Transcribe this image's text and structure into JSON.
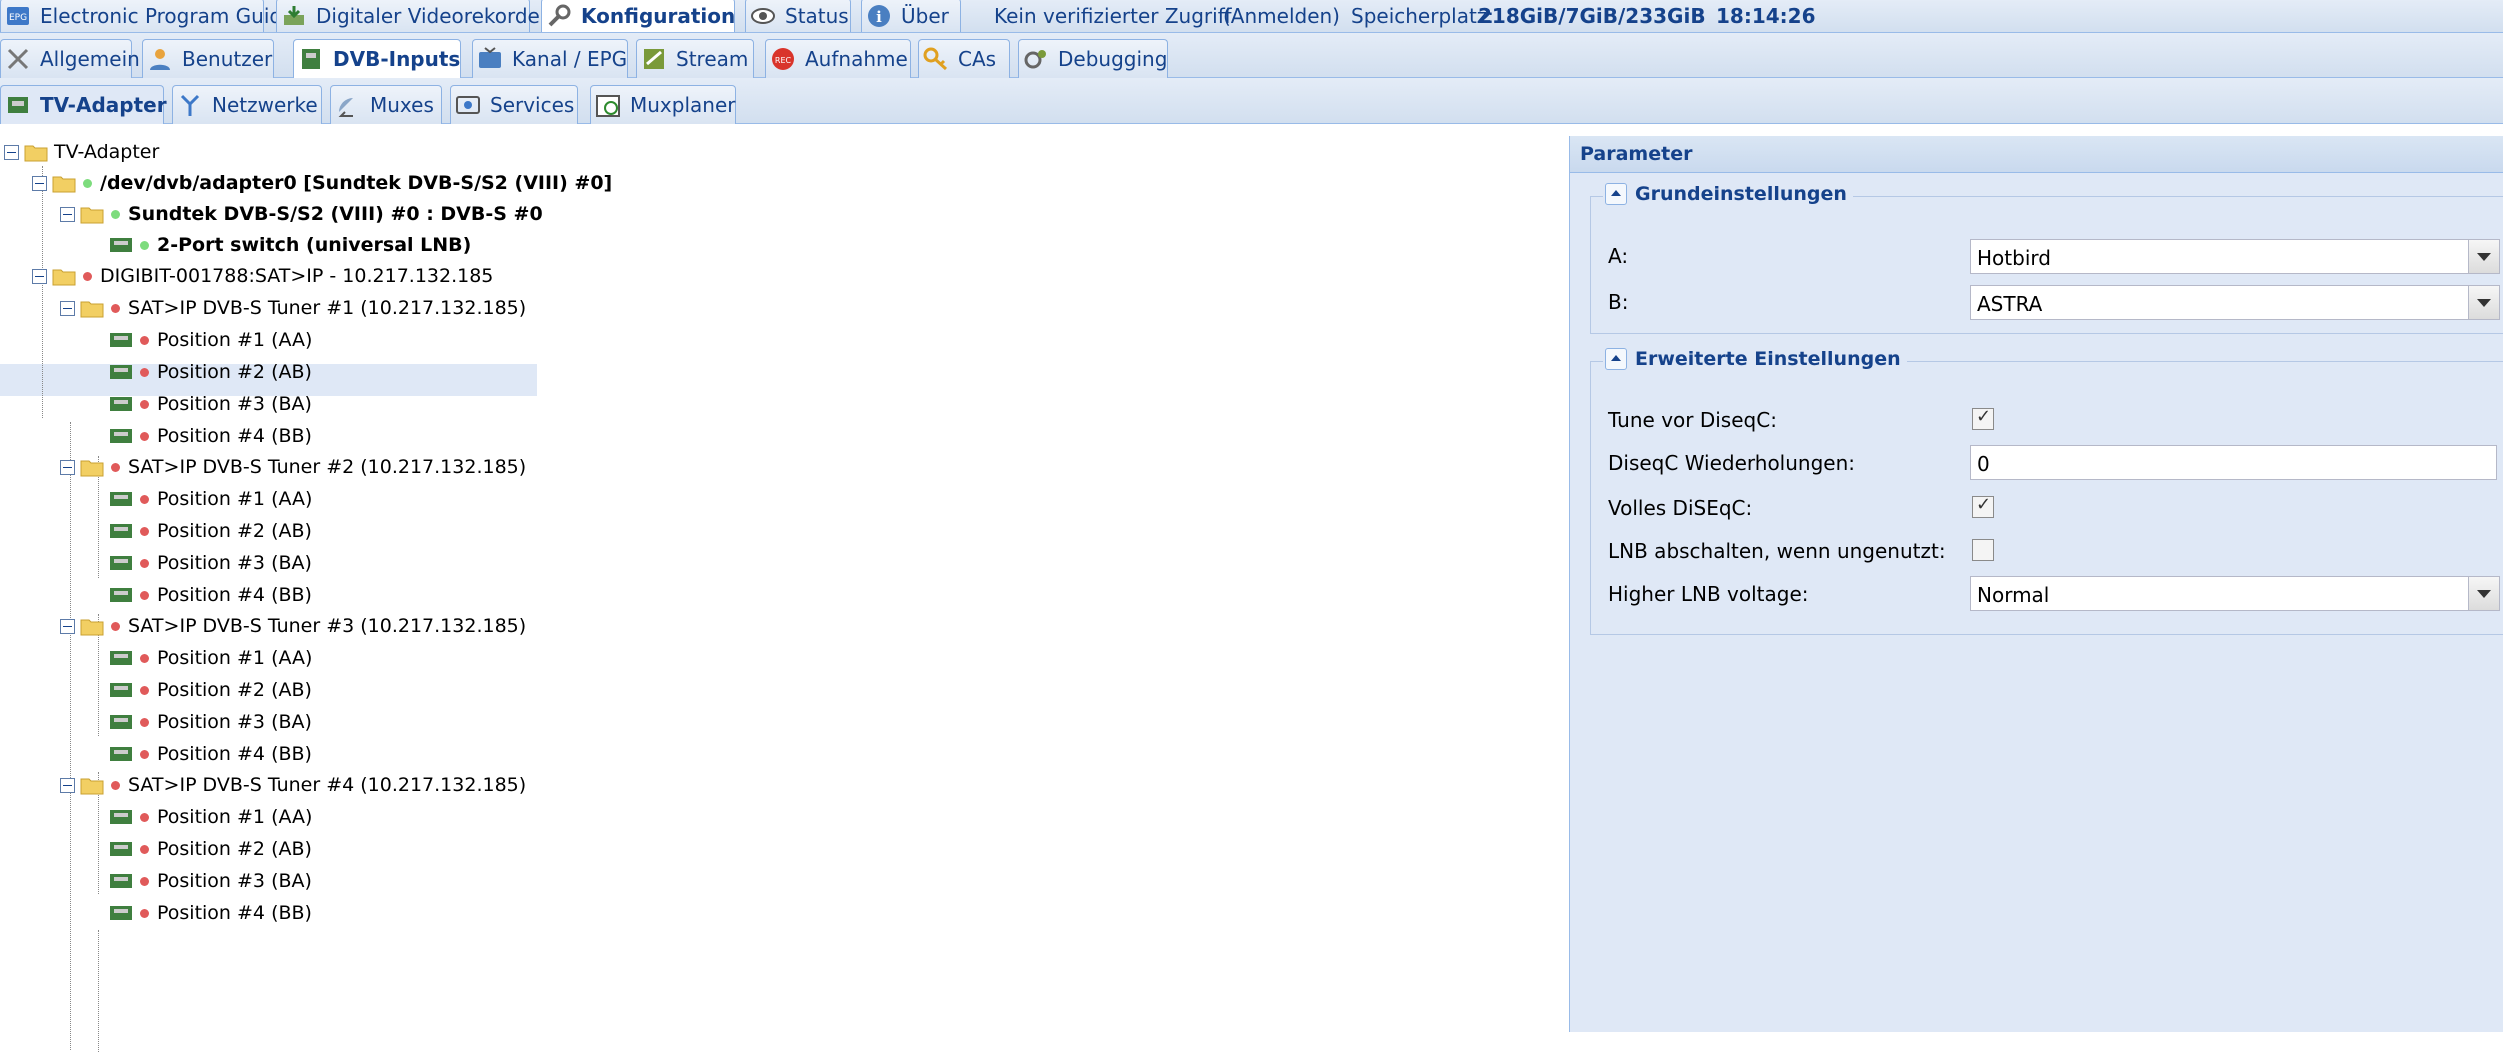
{
  "topbar": {
    "tabs": [
      {
        "label": "Electronic Program Guide",
        "icon": "epg-icon"
      },
      {
        "label": "Digitaler Videorekorder",
        "icon": "recorder-icon"
      },
      {
        "label": "Konfiguration",
        "icon": "wrench-icon"
      },
      {
        "label": "Status",
        "icon": "eye-icon"
      },
      {
        "label": "Über",
        "icon": "info-icon"
      }
    ],
    "access_text": "Kein verifizierter Zugriff",
    "login_link": "(Anmelden)",
    "storage_label": "Speicherplatz:",
    "storage_value": "218GiB/7GiB/233GiB",
    "clock": "18:14:26"
  },
  "config_tabs": [
    "Allgemein",
    "Benutzer",
    "DVB-Inputs",
    "Kanal / EPG",
    "Stream",
    "Aufnahme",
    "CAs",
    "Debugging"
  ],
  "dvb_tabs": [
    "TV-Adapter",
    "Netzwerke",
    "Muxes",
    "Services",
    "Muxplaner"
  ],
  "tree": {
    "root": "TV-Adapter",
    "adapter0": "/dev/dvb/adapter0 [Sundtek DVB-S/S2 (VIII) #0]",
    "frontend0": "Sundtek DVB-S/S2 (VIII) #0 : DVB-S #0",
    "switch": "2-Port switch (universal LNB)",
    "satip": "DIGIBIT-001788:SAT>IP - 10.217.132.185",
    "tuners": [
      "SAT>IP DVB-S Tuner #1 (10.217.132.185)",
      "SAT>IP DVB-S Tuner #2 (10.217.132.185)",
      "SAT>IP DVB-S Tuner #3 (10.217.132.185)",
      "SAT>IP DVB-S Tuner #4 (10.217.132.185)"
    ],
    "positions": [
      "Position #1 (AA)",
      "Position #2 (AB)",
      "Position #3 (BA)",
      "Position #4 (BB)"
    ]
  },
  "panel": {
    "title": "Parameter",
    "basic": {
      "legend": "Grundeinstellungen",
      "a_label": "A:",
      "a_value": "Hotbird",
      "b_label": "B:",
      "b_value": "ASTRA"
    },
    "advanced": {
      "legend": "Erweiterte Einstellungen",
      "tune_label": "Tune vor DiseqC:",
      "tune_checked": true,
      "repeats_label": "DiseqC Wiederholungen:",
      "repeats_value": "0",
      "full_label": "Volles DiSEqC:",
      "full_checked": true,
      "lnb_off_label": "LNB abschalten, wenn ungenutzt:",
      "lnb_off_checked": false,
      "voltage_label": "Higher LNB voltage:",
      "voltage_value": "Normal"
    }
  },
  "colors": {
    "accent": "#15428b",
    "toolbar": "#d2dfef",
    "selected": "#dfe8f6",
    "status_ok": "#7ddc7d",
    "status_err": "#e05a5a"
  }
}
